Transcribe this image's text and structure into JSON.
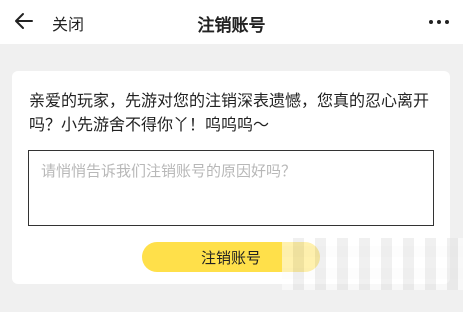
{
  "header": {
    "back_icon": "arrow-left-icon",
    "close_label": "关闭",
    "title": "注销账号",
    "more_icon": "more-dots-icon"
  },
  "main": {
    "message": "亲爱的玩家，先游对您的注销深表遗憾，您真的忍心离开吗？小先游舍不得你丫！呜呜呜～",
    "reason_placeholder": "请悄悄告诉我们注销账号的原因好吗？",
    "reason_value": "",
    "submit_label": "注销账号"
  },
  "colors": {
    "accent": "#ffe04a",
    "background": "#f0f0f0",
    "card": "#ffffff"
  }
}
